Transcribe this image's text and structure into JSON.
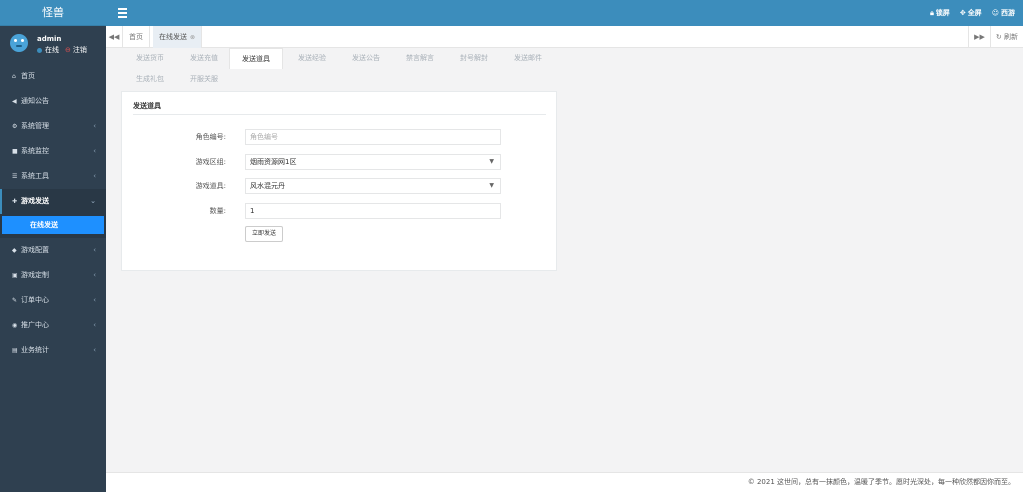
{
  "brand": "怪兽",
  "user": {
    "name": "admin",
    "online": "在线",
    "logout": "注销"
  },
  "menu": [
    {
      "icon": "home-icon",
      "glyph": "⌂",
      "label": "首页",
      "chevron": ""
    },
    {
      "icon": "bullhorn-icon",
      "glyph": "◀",
      "label": "通知公告",
      "chevron": ""
    },
    {
      "icon": "gear-icon",
      "glyph": "⚙",
      "label": "系统管理",
      "chevron": "‹"
    },
    {
      "icon": "video-icon",
      "glyph": "■",
      "label": "系统监控",
      "chevron": "‹"
    },
    {
      "icon": "list-icon",
      "glyph": "☰",
      "label": "系统工具",
      "chevron": "‹"
    },
    {
      "icon": "gift-icon",
      "glyph": "✚",
      "label": "游戏发送",
      "chevron": "⌄"
    },
    {
      "icon": "gamepad-icon",
      "glyph": "◆",
      "label": "游戏配置",
      "chevron": "‹"
    },
    {
      "icon": "cube-icon",
      "glyph": "▣",
      "label": "游戏定制",
      "chevron": "‹"
    },
    {
      "icon": "pencil-icon",
      "glyph": "✎",
      "label": "订单中心",
      "chevron": "‹"
    },
    {
      "icon": "eye-icon",
      "glyph": "◉",
      "label": "推广中心",
      "chevron": "‹"
    },
    {
      "icon": "table-icon",
      "glyph": "▤",
      "label": "业务统计",
      "chevron": "‹"
    }
  ],
  "submenu_selected": "在线发送",
  "header": {
    "lock": "锁屏",
    "fullscreen": "全屏",
    "user": "西游"
  },
  "tabs": {
    "home": "首页",
    "current": "在线发送",
    "refresh": "刷新"
  },
  "subnav": [
    "发送货币",
    "发送充值",
    "发送道具",
    "发送经验",
    "发送公告",
    "禁言解言",
    "封号解封",
    "发送邮件",
    "生成礼包",
    "开服关服"
  ],
  "form": {
    "title": "发送道具",
    "role_label": "角色编号:",
    "role_placeholder": "角色编号",
    "zone_label": "游戏区组:",
    "zone_value": "烟雨资源网1区",
    "item_label": "游戏道具:",
    "item_value": "风水混元丹",
    "qty_label": "数量:",
    "qty_value": "1",
    "submit": "立即发送"
  },
  "footer": "© 2021 这世间，总有一抹颜色，温暖了季节。愿时光深处，每一种欣然都因你而至。",
  "colors": {
    "accent": "#3c8dbc",
    "sidebar": "#2f4050",
    "selected": "#1e90ff"
  }
}
